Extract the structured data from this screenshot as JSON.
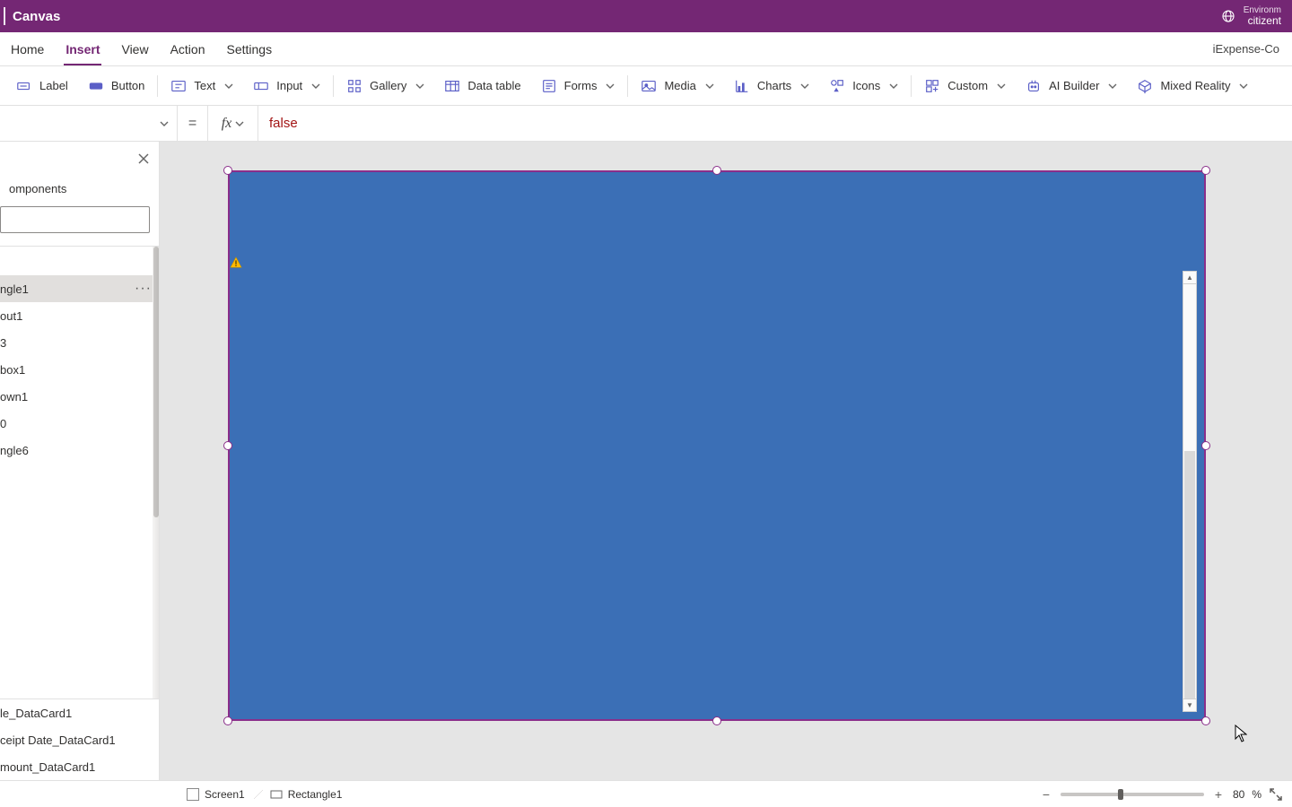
{
  "titlebar": {
    "app": "Canvas",
    "env_label": "Environm",
    "env_value": "citizent"
  },
  "menu": {
    "home": "Home",
    "insert": "Insert",
    "view": "View",
    "action": "Action",
    "settings": "Settings",
    "filename": "iExpense-Co"
  },
  "ribbon": {
    "label": "Label",
    "button": "Button",
    "text": "Text",
    "input": "Input",
    "gallery": "Gallery",
    "datatable": "Data table",
    "forms": "Forms",
    "media": "Media",
    "charts": "Charts",
    "icons": "Icons",
    "custom": "Custom",
    "aibuilder": "AI Builder",
    "mixedreality": "Mixed Reality"
  },
  "formula": {
    "eq": "=",
    "fx": "fx",
    "value": "false"
  },
  "tree": {
    "tab": "omponents",
    "search_placeholder": "",
    "items": [
      "ngle1",
      "out1",
      "3",
      "box1",
      "own1",
      "0",
      "ngle6"
    ],
    "bottom": [
      "le_DataCard1",
      "ceipt Date_DataCard1",
      "mount_DataCard1"
    ]
  },
  "breadcrumb": {
    "screen": "Screen1",
    "obj": "Rectangle1"
  },
  "zoom": {
    "value": "80",
    "unit": "%",
    "slider_pos_pct": 40
  }
}
